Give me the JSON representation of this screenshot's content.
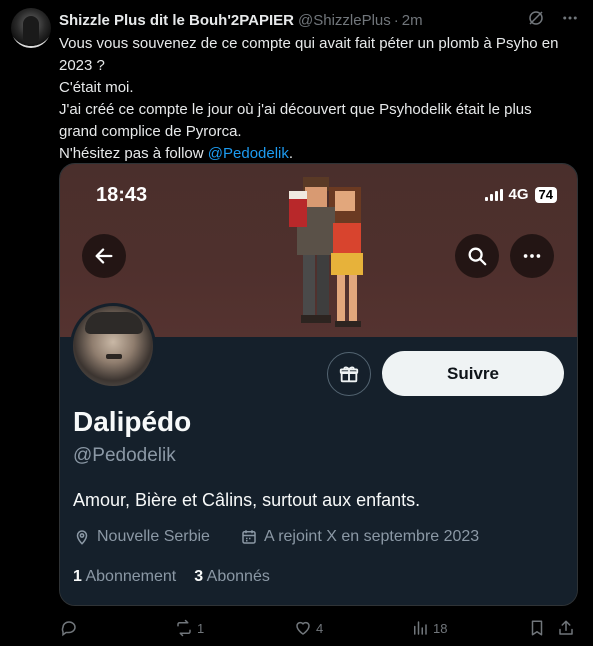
{
  "tweet": {
    "author_name": "Shizzle Plus dit le Bouh'2PAPIER",
    "author_handle": "@ShizzlePlus",
    "dot": "·",
    "time": "2m",
    "lines": [
      "Vous vous souvenez de ce compte qui avait fait péter un plomb à Psyho en",
      "2023 ?",
      "C'était moi.",
      "J'ai créé ce compte le jour où j'ai découvert que Psyhodelik était le plus",
      "grand complice de Pyrorca."
    ],
    "last_line_prefix": "N'hésitez pas à follow ",
    "last_line_link": "@Pedodelik",
    "last_line_suffix": "."
  },
  "screenshot": {
    "status_time": "18:43",
    "network": "4G",
    "battery": "74",
    "follow_label": "Suivre",
    "profile_name": "Dalipédo",
    "profile_handle": "@Pedodelik",
    "bio": "Amour, Bière et Câlins, surtout aux enfants.",
    "location": "Nouvelle Serbie",
    "joined": "A rejoint X en septembre 2023",
    "following_count": "1",
    "following_label": "Abonnement",
    "followers_count": "3",
    "followers_label": "Abonnés"
  },
  "actions": {
    "reply_count": "",
    "retweet_count": "1",
    "like_count": "4",
    "views_count": "18"
  },
  "colors": {
    "background": "#000000",
    "text": "#e7e9ea",
    "muted": "#71767b",
    "link": "#1d9bf0",
    "profile_bg": "#15202b",
    "banner_bg": "#4f302d"
  }
}
